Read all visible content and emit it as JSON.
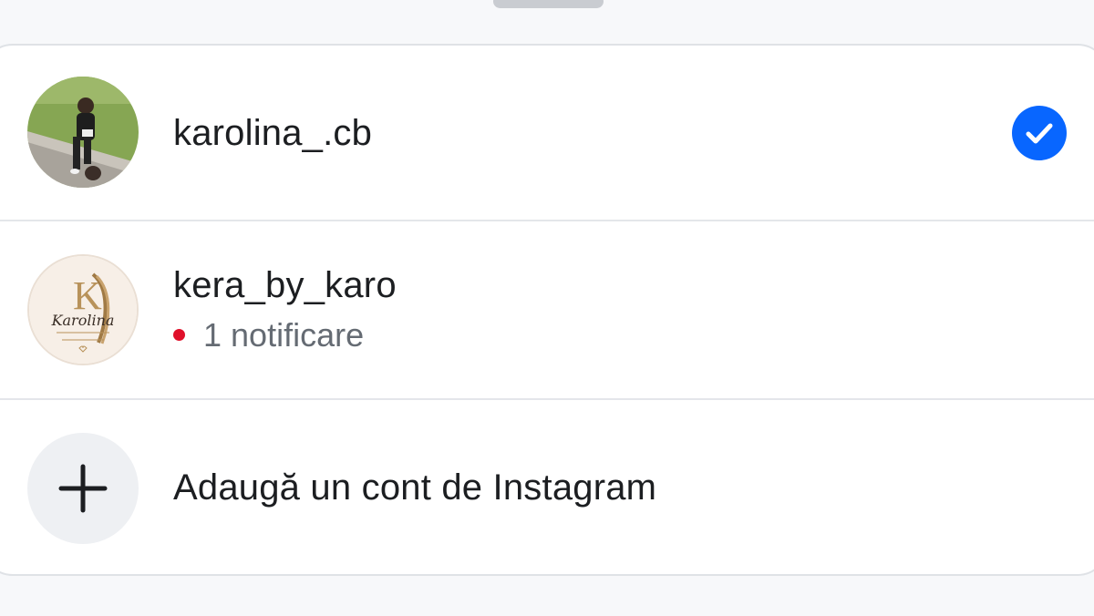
{
  "accounts": [
    {
      "username": "karolina_.cb",
      "selected": true,
      "avatar_icon": "profile-photo"
    },
    {
      "username": "kera_by_karo",
      "notification": "1 notificare",
      "avatar_icon": "karolina-keratin-logo",
      "logo_text": "Karolina"
    }
  ],
  "add_account": {
    "label": "Adaugă un cont de Instagram",
    "icon": "plus-icon"
  },
  "colors": {
    "accent": "#0866ff",
    "notification_dot": "#e0102a"
  }
}
